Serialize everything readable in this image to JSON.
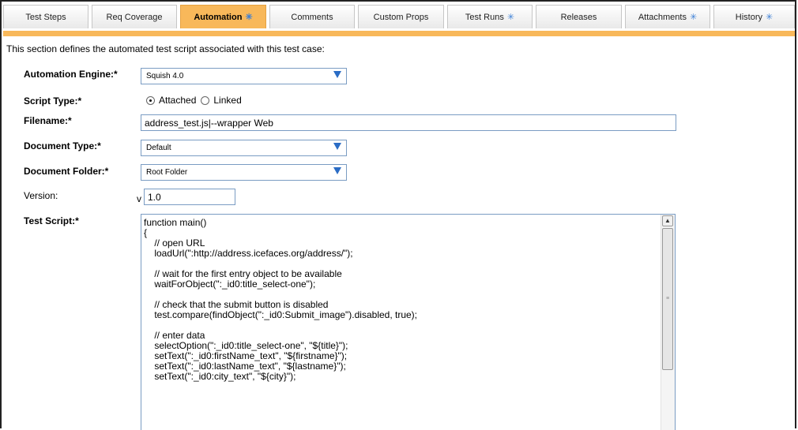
{
  "tabs": [
    {
      "label": "Test Steps",
      "star": false
    },
    {
      "label": "Req Coverage",
      "star": false
    },
    {
      "label": "Automation",
      "star": true,
      "active": true
    },
    {
      "label": "Comments",
      "star": false
    },
    {
      "label": "Custom Props",
      "star": false
    },
    {
      "label": "Test Runs",
      "star": true
    },
    {
      "label": "Releases",
      "star": false
    },
    {
      "label": "Attachments",
      "star": true
    },
    {
      "label": "History",
      "star": true
    }
  ],
  "star_glyph": "✳",
  "intro": "This section defines the automated test script associated with this test case:",
  "form": {
    "engine_label": "Automation Engine:*",
    "engine_value": "Squish 4.0",
    "script_type_label": "Script Type:*",
    "script_type_options": [
      "Attached",
      "Linked"
    ],
    "script_type_selected": "Attached",
    "filename_label": "Filename:*",
    "filename_value": "address_test.js|--wrapper Web",
    "doctype_label": "Document Type:*",
    "doctype_value": "Default",
    "folder_label": "Document Folder:*",
    "folder_value": "Root Folder",
    "version_label": "Version:",
    "version_prefix": "v",
    "version_value": "1.0",
    "script_label": "Test Script:*",
    "script_text": "function main()\n{\n    // open URL\n    loadUrl(\":http://address.icefaces.org/address/\");\n\n    // wait for the first entry object to be available\n    waitForObject(\":_id0:title_select-one\");\n\n    // check that the submit button is disabled\n    test.compare(findObject(\":_id0:Submit_image\").disabled, true);\n\n    // enter data\n    selectOption(\":_id0:title_select-one\", \"${title}\");\n    setText(\":_id0:firstName_text\", \"${firstname}\");\n    setText(\":_id0:lastName_text\", \"${lastname}\");\n    setText(\":_id0:city_text\", \"${city}\");"
  },
  "colors": {
    "accent": "#f8b85a",
    "star": "#3b7fd6",
    "field_border": "#7a9cc3",
    "arrow": "#2a6cc5"
  }
}
